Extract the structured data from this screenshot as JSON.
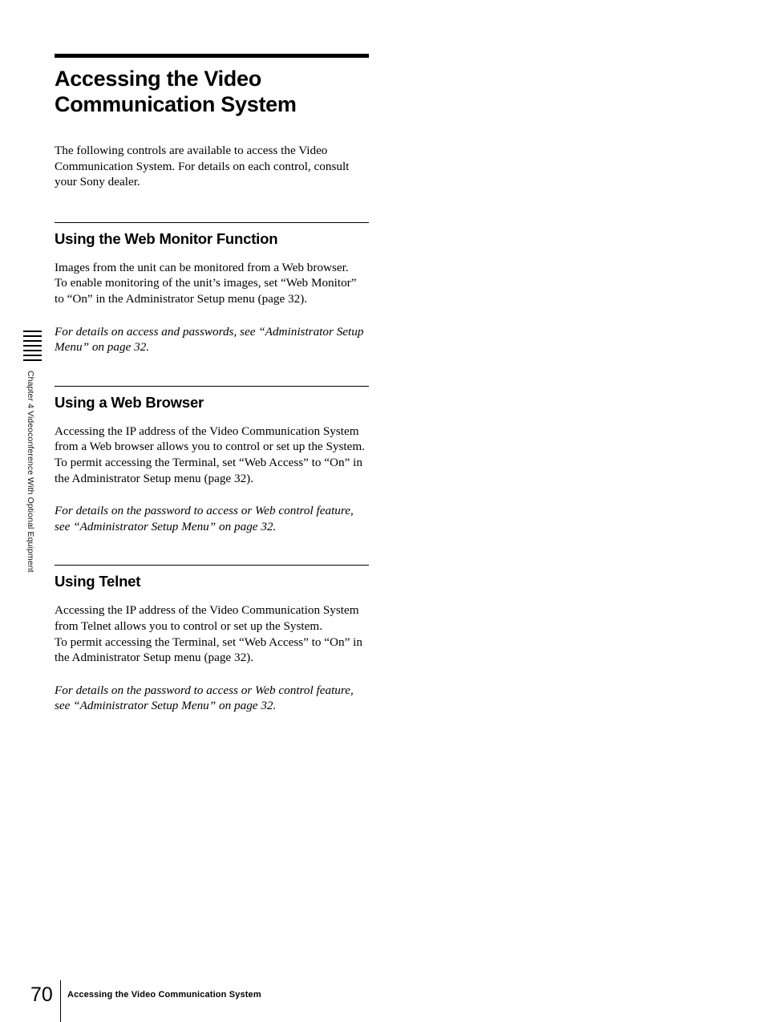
{
  "document": {
    "page_number": "70",
    "footer_title": "Accessing the Video Communication System",
    "chapter_label": "Chapter 4  Videoconference With Optional Equipment",
    "tab_mark_count": 7
  },
  "title": {
    "line1": "Accessing the Video",
    "line2": "Communication System"
  },
  "intro": {
    "text": "The following controls are available to access the Video Communication System. For details on each control, consult your Sony dealer."
  },
  "sections": [
    {
      "heading": "Using the Web Monitor Function",
      "body": "Images from the unit can be monitored from a Web browser.\nTo enable monitoring of the unit’s images, set “Web Monitor” to “On” in the Administrator Setup menu (page 32).",
      "reference": "For details on access and passwords, see “Administrator Setup Menu” on page 32."
    },
    {
      "heading": "Using a Web Browser",
      "body": "Accessing the IP address of the Video Communication System from a Web browser allows you to control or set up the System.\nTo permit accessing the Terminal, set “Web Access” to “On” in the Administrator Setup menu (page 32).",
      "reference": "For details on the password to access or Web control feature, see “Administrator Setup Menu” on page 32."
    },
    {
      "heading": "Using Telnet",
      "body": "Accessing the IP address of the Video Communication System from Telnet allows you to control or set up the System.\nTo permit accessing the Terminal, set “Web Access” to “On” in the Administrator Setup menu (page 32).",
      "reference": "For details on the password to access or Web control feature, see “Administrator Setup Menu” on page 32."
    }
  ],
  "colors": {
    "text": "#000000",
    "background": "#ffffff"
  }
}
